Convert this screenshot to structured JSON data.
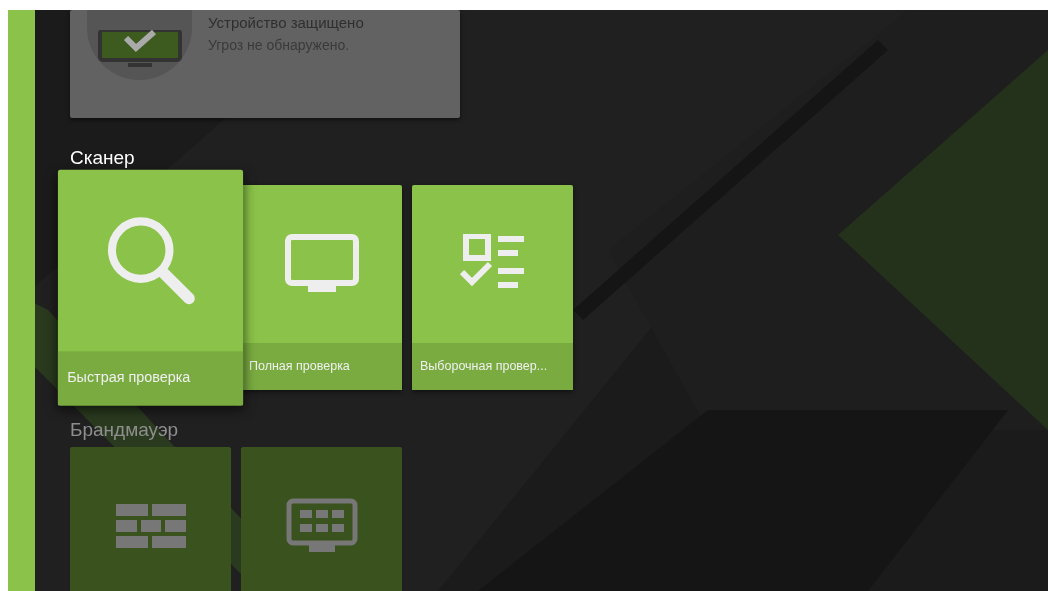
{
  "status_card": {
    "title": "Устройство защищено",
    "subtitle": "Угроз не обнаружено."
  },
  "sections": [
    {
      "title": "Сканер",
      "disabled": false,
      "tiles": [
        {
          "kind": "search",
          "label": "Быстрая проверка",
          "selected": true
        },
        {
          "kind": "monitor",
          "label": "Полная проверка",
          "selected": false
        },
        {
          "kind": "checklist",
          "label": "Выборочная провер...",
          "selected": false
        }
      ]
    },
    {
      "title": "Брандмауэр",
      "disabled": true,
      "tiles": [
        {
          "kind": "brickwall",
          "selected": false
        },
        {
          "kind": "monitor-grid",
          "selected": false
        }
      ]
    }
  ]
}
